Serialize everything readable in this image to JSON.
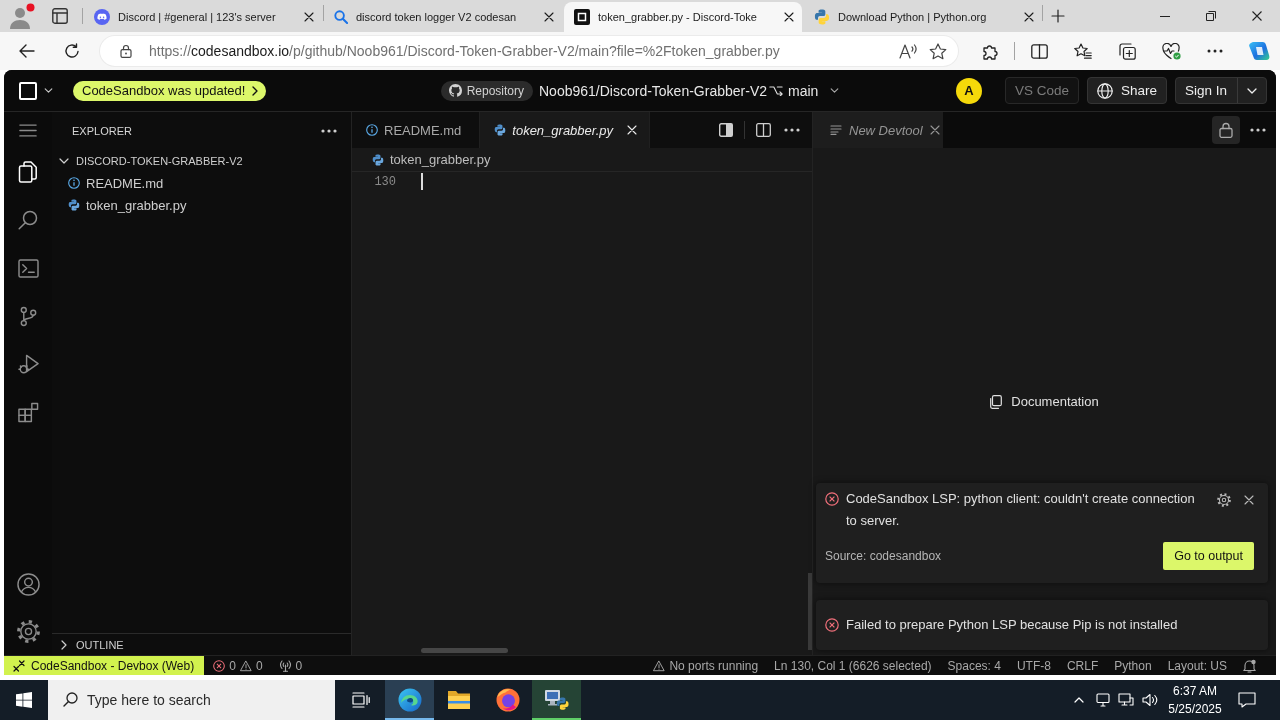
{
  "browser": {
    "tabs": [
      {
        "title": "Discord | #general | 123's server",
        "kind": "discord",
        "selected": false
      },
      {
        "title": "discord token logger V2 codesan",
        "kind": "search",
        "selected": false
      },
      {
        "title": "token_grabber.py - Discord-Toke",
        "kind": "codesandbox",
        "selected": true
      },
      {
        "title": "Download Python | Python.org",
        "kind": "python",
        "selected": false
      }
    ],
    "address": "https://codesandbox.io/p/github/Noob961/Discord-Token-Grabber-V2/main?file=%2Ftoken_grabber.py"
  },
  "header": {
    "update_badge": "CodeSandbox was updated!",
    "repository_label": "Repository",
    "repo_name": "Noob961/Discord-Token-Grabber-V2",
    "branch": "main",
    "avatar": "A",
    "buttons": [
      {
        "label": "VS Code",
        "kind": "plain",
        "disabled": true
      },
      {
        "label": "Share",
        "kind": "globe",
        "disabled": false
      },
      {
        "label": "Sign In",
        "kind": "split",
        "disabled": false
      }
    ]
  },
  "activity_bar": {
    "items": [
      {
        "selected": true
      },
      {
        "selected": false
      },
      {
        "selected": false
      },
      {
        "selected": false
      },
      {
        "selected": false
      },
      {
        "selected": false
      }
    ]
  },
  "explorer": {
    "title": "EXPLORER",
    "root": {
      "name": "DISCORD-TOKEN-GRABBER-V2",
      "expanded": true,
      "children": [
        {
          "name": "README.md",
          "kind": "info"
        },
        {
          "name": "token_grabber.py",
          "kind": "python"
        }
      ]
    },
    "outline": {
      "label": "OUTLINE",
      "expanded": false
    }
  },
  "editor": {
    "tabs": [
      {
        "label": "README.md",
        "kind": "info",
        "selected": false,
        "preview": false
      },
      {
        "label": "token_grabber.py",
        "kind": "python",
        "selected": true,
        "preview": true
      }
    ],
    "breadcrumb": {
      "label": "token_grabber.py",
      "kind": "python"
    },
    "lines": [
      {
        "number": "130",
        "cursor": true
      }
    ]
  },
  "devtool": {
    "tabs": [
      {
        "label": "New Devtool",
        "selected": true,
        "preview": true
      }
    ],
    "documentation": "Documentation"
  },
  "notifications": [
    {
      "kind": "error",
      "expanded": true,
      "message": "CodeSandbox LSP: python client: couldn't create connection to server.",
      "source": "Source: codesandbox",
      "action": "Go to output"
    },
    {
      "kind": "error",
      "expanded": false,
      "message": "Failed to prepare Python LSP because Pip is not installed"
    }
  ],
  "status_bar": {
    "remote": "CodeSandbox - Devbox (Web)",
    "errors": "0",
    "warnings": "0",
    "ports": "0",
    "items": [
      {
        "kind": "warning",
        "label": "No ports running"
      },
      {
        "kind": "text",
        "label": "Ln 130, Col 1 (6626 selected)"
      },
      {
        "kind": "text",
        "label": "Spaces: 4"
      },
      {
        "kind": "text",
        "label": "UTF-8"
      },
      {
        "kind": "text",
        "label": "CRLF"
      },
      {
        "kind": "text",
        "label": "Python"
      },
      {
        "kind": "text",
        "label": "Layout: US"
      }
    ]
  },
  "taskbar": {
    "search": {
      "placeholder": "Type here to search"
    },
    "apps": [
      {
        "kind": "edge",
        "open": true,
        "color": "#76b9ed"
      },
      {
        "kind": "folder",
        "open": false
      },
      {
        "kind": "firefox",
        "open": false
      },
      {
        "kind": "python-tool",
        "open": true,
        "color": "#5fd068"
      }
    ],
    "time": "6:37 AM",
    "date": "5/25/2025"
  }
}
